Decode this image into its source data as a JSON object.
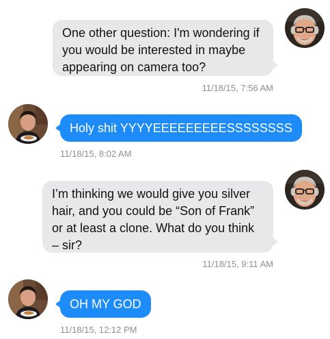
{
  "messages": [
    {
      "sender": "incoming",
      "text": "One other question: I'm wondering if you would be interested in maybe appearing on camera too?",
      "timestamp": "11/18/15, 7:56 AM",
      "avatar": "older-man-avatar"
    },
    {
      "sender": "outgoing",
      "text": "Holy shit YYYYEEEEEEEEESSSSSSSS",
      "timestamp": "11/18/15, 8:02 AM",
      "avatar": "young-man-avatar"
    },
    {
      "sender": "incoming",
      "text": "I’m thinking we would give you silver hair, and you could be “Son of Frank” or at least a clone. What do you think – sir?",
      "timestamp": "11/18/15, 9:11 AM",
      "avatar": "older-man-avatar"
    },
    {
      "sender": "outgoing",
      "text": "OH MY GOD",
      "timestamp": "11/18/15, 12:12 PM",
      "avatar": "young-man-avatar"
    }
  ],
  "colors": {
    "incoming_bubble": "#e8e8ea",
    "outgoing_bubble": "#1d8cf8",
    "timestamp": "#8e8e93"
  }
}
